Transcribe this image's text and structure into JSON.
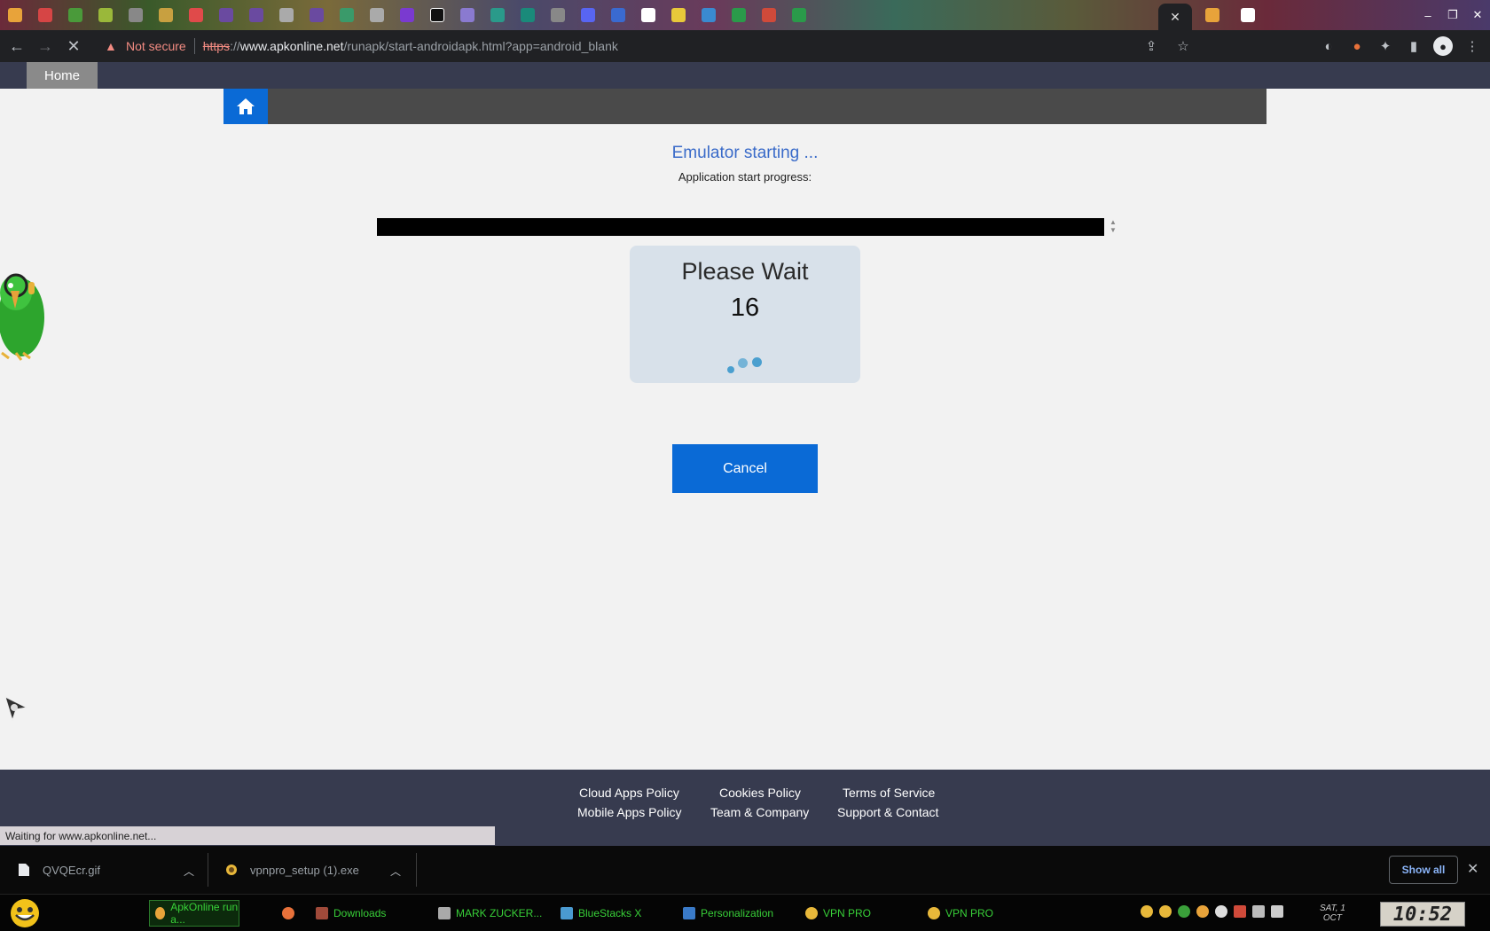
{
  "browser": {
    "security_label": "Not secure",
    "url_scheme": "https",
    "url_separator": "://",
    "url_host": "www.apkonline.net",
    "url_path": "/runapk/start-androidapk.html?app=android_blank",
    "status_text": "Waiting for www.apkonline.net..."
  },
  "site_nav": {
    "home_label": "Home"
  },
  "main": {
    "status_title": "Emulator starting ...",
    "status_sub": "Application start progress:",
    "progress_percent": 100,
    "wait_title": "Please Wait",
    "wait_count": "16",
    "cancel_label": "Cancel"
  },
  "footer": {
    "links": [
      "Cloud Apps Policy",
      "Cookies Policy",
      "Terms of Service",
      "Mobile Apps Policy",
      "Team & Company",
      "Support & Contact"
    ]
  },
  "downloads": {
    "items": [
      "QVQEcr.gif",
      "vpnpro_setup (1).exe"
    ],
    "show_all_label": "Show all"
  },
  "taskbar": {
    "items": [
      "ApkOnline run a...",
      "Downloads",
      "MARK ZUCKER...",
      "BlueStacks X",
      "Personalization",
      "VPN PRO",
      "VPN PRO"
    ],
    "date_line1": "SAT, 1",
    "date_line2": "OCT",
    "clock": "10:52"
  },
  "colors": {
    "accent_blue": "#0a6ad6",
    "title_blue": "#3a6bc9",
    "nav_bg": "#373b4f",
    "taskbar_text": "#38d038"
  }
}
